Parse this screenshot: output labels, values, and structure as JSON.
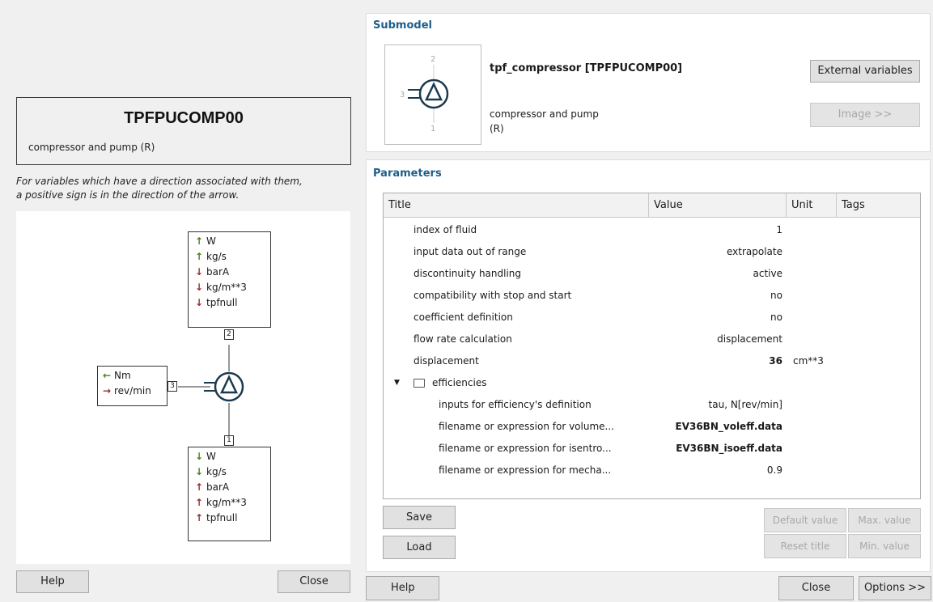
{
  "left": {
    "model_code": "TPFPUCOMP00",
    "model_desc": "compressor and pump (R)",
    "direction_note_line1": "For variables which have a direction associated with them,",
    "direction_note_line2": "a positive sign is in the direction of the arrow.",
    "port2_vars": [
      "W",
      "kg/s",
      "barA",
      "kg/m**3",
      "tpfnull"
    ],
    "port1_vars": [
      "W",
      "kg/s",
      "barA",
      "kg/m**3",
      "tpfnull"
    ],
    "port3_vars": [
      "Nm",
      "rev/min"
    ],
    "port_labels": {
      "p1": "1",
      "p2": "2",
      "p3": "3"
    },
    "help_label": "Help",
    "close_label": "Close"
  },
  "submodel": {
    "section_title": "Submodel",
    "name": "tpf_compressor [TPFPUCOMP00]",
    "desc_line1": "compressor and pump",
    "desc_line2": "(R)",
    "external_variables_label": "External variables",
    "image_label": "Image >>",
    "thumb_ports": {
      "p1": "1",
      "p2": "2",
      "p3": "3"
    }
  },
  "parameters": {
    "section_title": "Parameters",
    "columns": [
      "Title",
      "Value",
      "Unit",
      "Tags"
    ],
    "rows": [
      {
        "title": "index of fluid",
        "value": "1",
        "unit": ""
      },
      {
        "title": "input data out of range",
        "value": "extrapolate",
        "unit": ""
      },
      {
        "title": "discontinuity handling",
        "value": "active",
        "unit": ""
      },
      {
        "title": "compatibility with stop and start",
        "value": "no",
        "unit": ""
      },
      {
        "title": "coefficient definition",
        "value": "no",
        "unit": ""
      },
      {
        "title": "flow rate calculation",
        "value": "displacement",
        "unit": ""
      },
      {
        "title": "displacement",
        "value": "36",
        "unit": "cm**3"
      },
      {
        "title": "efficiencies",
        "value": "",
        "unit": ""
      },
      {
        "title": "inputs for efficiency's definition",
        "value": "tau, N[rev/min]",
        "unit": ""
      },
      {
        "title": "filename or expression for volume...",
        "value": "EV36BN_voleff.data",
        "unit": ""
      },
      {
        "title": "filename or expression for isentro...",
        "value": "EV36BN_isoeff.data",
        "unit": ""
      },
      {
        "title": "filename or expression for mecha...",
        "value": "0.9",
        "unit": ""
      }
    ],
    "save_label": "Save",
    "load_label": "Load",
    "default_value_label": "Default value",
    "max_value_label": "Max. value",
    "reset_title_label": "Reset title",
    "min_value_label": "Min. value"
  },
  "footer": {
    "help_label": "Help",
    "close_label": "Close",
    "options_label": "Options >>"
  },
  "colors": {
    "section_title": "#1f5e8c",
    "arrow_green": "#4f7a1f",
    "arrow_red": "#9a2b35"
  }
}
